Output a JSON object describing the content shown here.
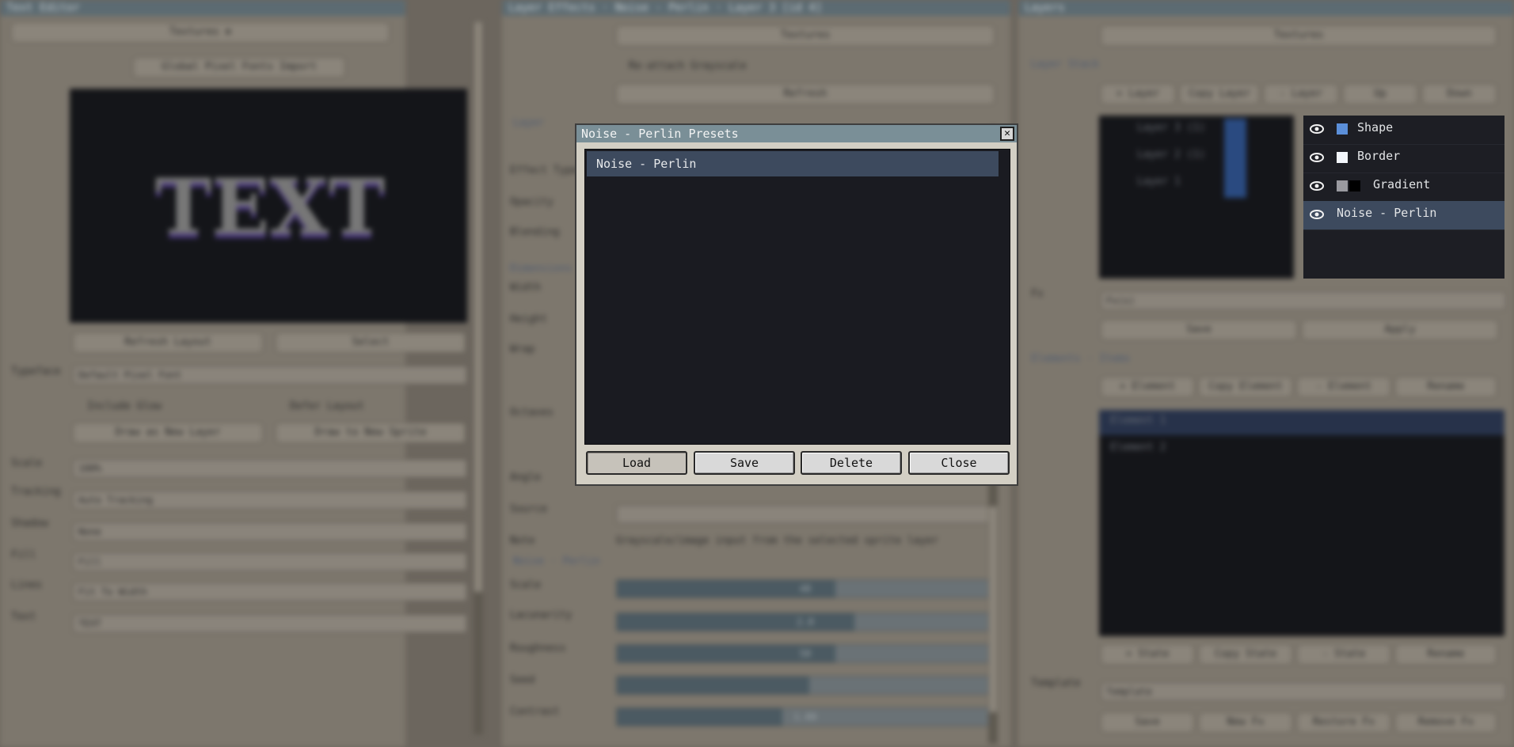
{
  "colors": {
    "background": "#6c665e",
    "panel": "#7d776d",
    "selection": "#3d4a5e",
    "modal_title": "#7a8f97",
    "shape_swatch": "#5b8fd9",
    "border_swatch": "#f2f6fb",
    "gradient_swatch_a": "#9a9aa0",
    "gradient_swatch_b": "#000000"
  },
  "left_panel": {
    "title": "Text Editor",
    "textures_button": "Textures ⊕",
    "tabs": "Global Pixel Fonts Import",
    "preview_text": "TEXT",
    "refresh_button": "Refresh Layout",
    "select_button": "Select",
    "typeface_label": "Typeface",
    "typeface_value": "Default Pixel Font",
    "include_glow": "Include Glow",
    "defer_layout": "Defer Layout",
    "draw_new_layer": "Draw as New Layer",
    "draw_new_sprite": "Draw to New Sprite",
    "rows": [
      {
        "label": "Scale",
        "value": "100%"
      },
      {
        "label": "Tracking",
        "value": "Auto Tracking"
      },
      {
        "label": "Shadow",
        "value": "None"
      },
      {
        "label": "Fill",
        "value": "Fill"
      },
      {
        "label": "Lines",
        "value": "Fit To Width"
      },
      {
        "label": "Text",
        "value": "TEXT"
      }
    ]
  },
  "middle_panel": {
    "title": "Layer Effects · Noise - Perlin · Layer 3 [id 4]",
    "textures_button": "Textures",
    "checkbox": "Re-attach Grayscale",
    "refresh_button": "Refresh",
    "section_layer": "Layer",
    "labels": [
      "Effect Type",
      "Opacity",
      "Blending",
      "Dimensions",
      "Width",
      "Height",
      "Wrap",
      "Octaves",
      "Angle",
      "Source",
      "Note"
    ],
    "note_text": "Grayscale/image input from the selected sprite layer",
    "section_noise": "Noise · Perlin",
    "sliders": [
      {
        "label": "Scale",
        "value": "48",
        "fraction": 0.58
      },
      {
        "label": "Lacunarity",
        "value": "2.0",
        "fraction": 0.63
      },
      {
        "label": "Roughness",
        "value": "50",
        "fraction": 0.58
      },
      {
        "label": "Seed",
        "value": "",
        "fraction": 0.51
      },
      {
        "label": "Contrast",
        "value": "1.00",
        "fraction": 0.44
      }
    ]
  },
  "right_panel": {
    "title": "Layers",
    "textures_button": "Textures",
    "section_layer_stack": "Layer Stack",
    "stack_buttons": [
      "+ Layer",
      "Copy Layer",
      "- Layer",
      "Up",
      "Down"
    ],
    "stack_layers": [
      "Layer 3 (1)",
      "Layer 2 (1)",
      "Layer 1"
    ],
    "effects": [
      {
        "name": "Shape",
        "visible": true,
        "selected": false
      },
      {
        "name": "Border",
        "visible": true,
        "selected": false
      },
      {
        "name": "Gradient",
        "visible": true,
        "selected": false
      },
      {
        "name": "Noise - Perlin",
        "visible": true,
        "selected": true
      }
    ],
    "fx_label": "Fx",
    "fx_value": "Fx(s)",
    "save_button": "Save",
    "apply_button": "Apply",
    "section_elements": "Elements · Items",
    "element_buttons": [
      "+ Element",
      "Copy Element",
      "- Element",
      "Rename"
    ],
    "elements": [
      "Element 1",
      "Element 2"
    ],
    "state_buttons": [
      "+ State",
      "Copy State",
      "- State",
      "Rename"
    ],
    "template_label": "Template",
    "template_value": "Template",
    "bottom_buttons": [
      "Save",
      "New Fx",
      "Restore Fx",
      "Remove Fx"
    ]
  },
  "modal": {
    "title": "Noise - Perlin Presets",
    "close_glyph": "✕",
    "presets": [
      "Noise - Perlin"
    ],
    "buttons": {
      "load": "Load",
      "save": "Save",
      "delete": "Delete",
      "close": "Close"
    }
  }
}
